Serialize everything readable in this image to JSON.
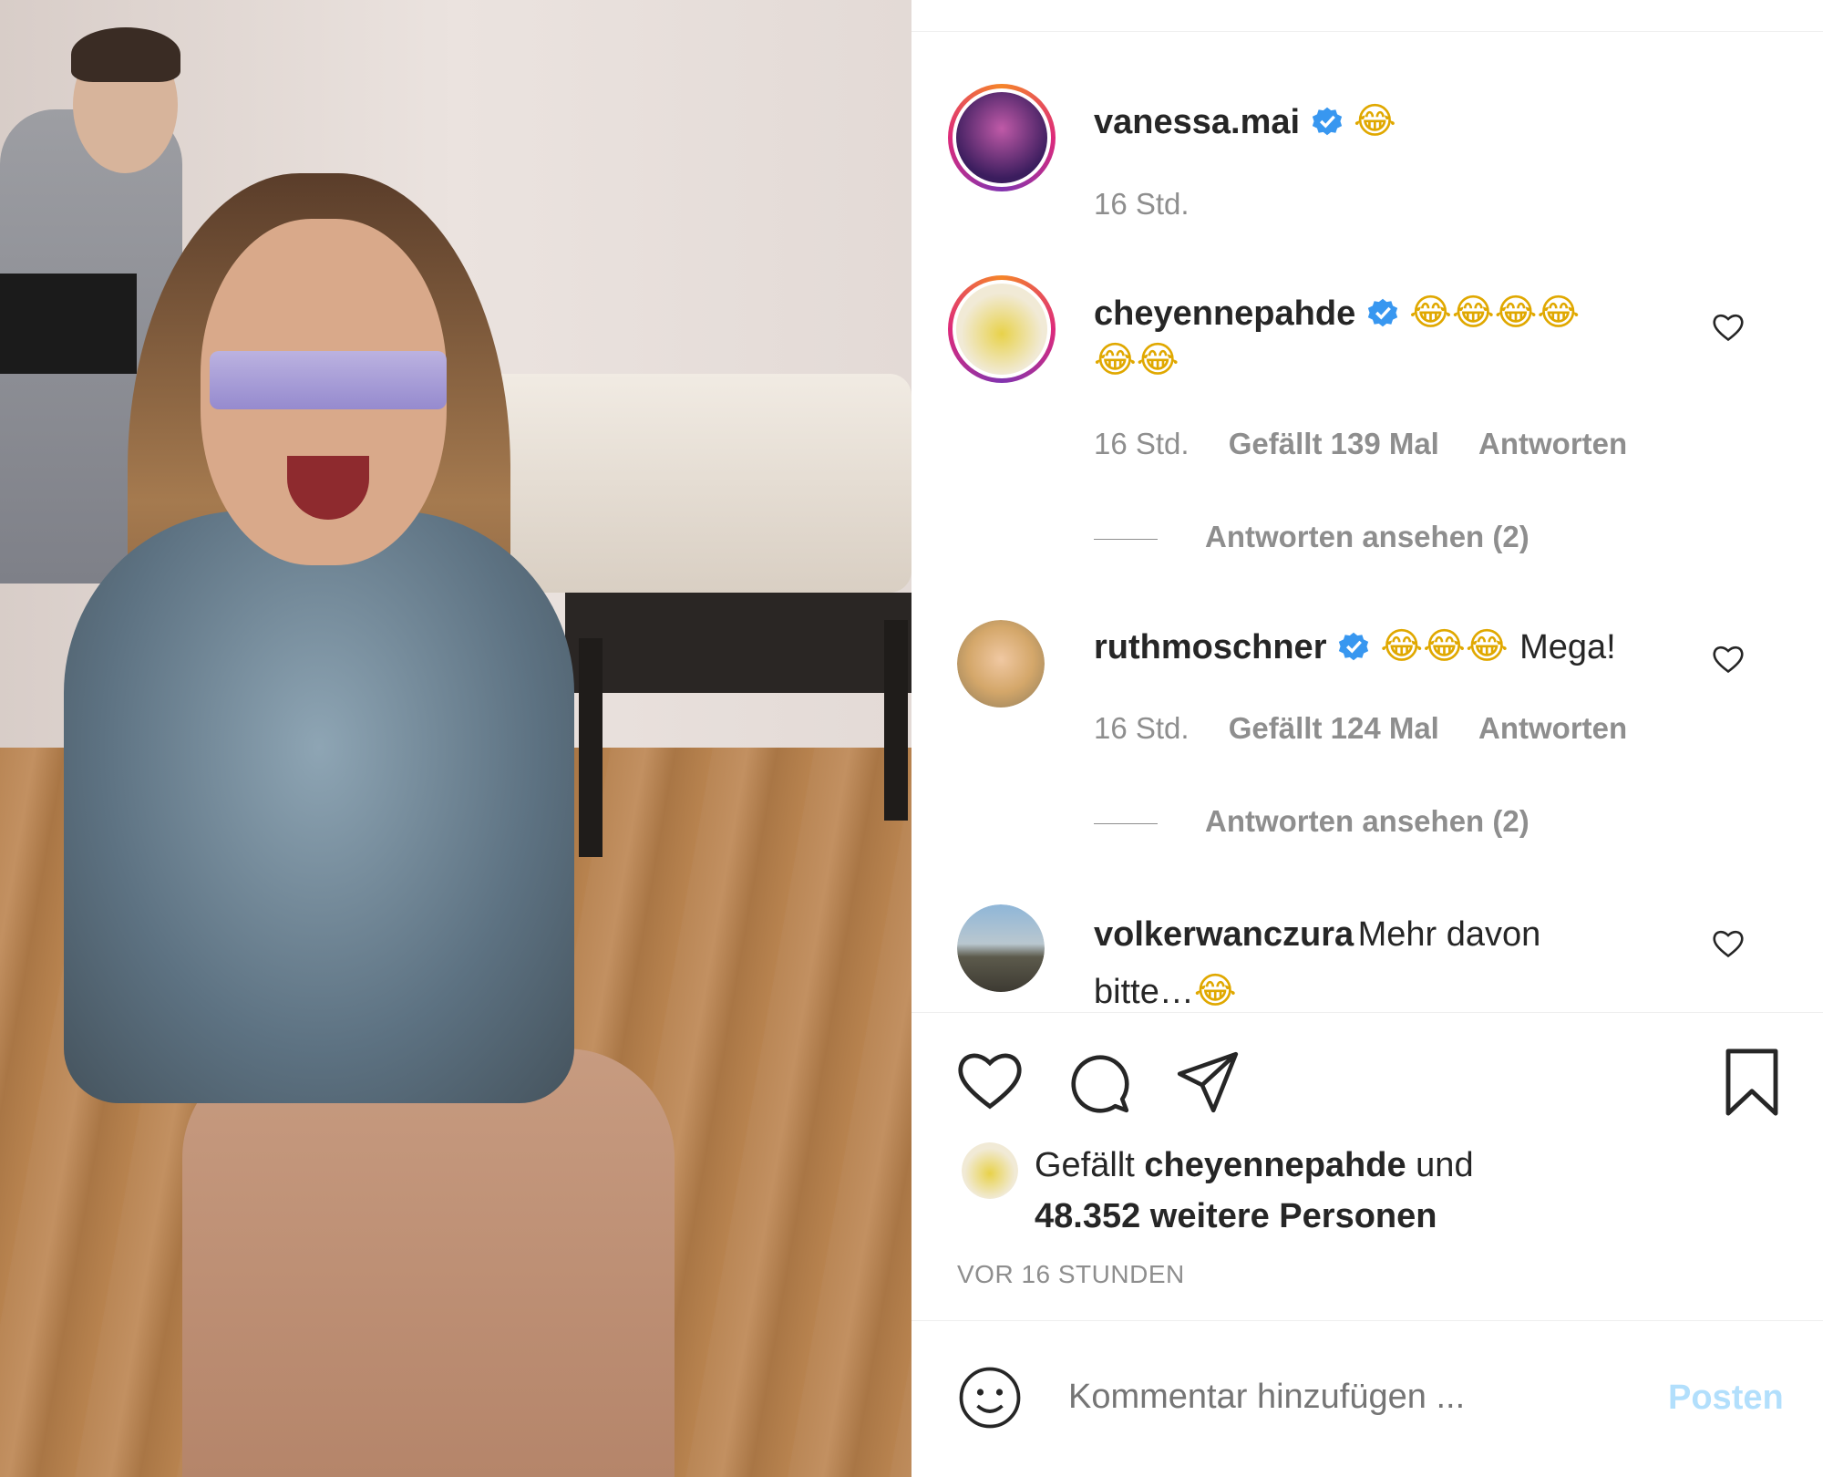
{
  "post": {
    "author": "vanessa.mai",
    "caption_emoji": "😂",
    "time": "16 Std."
  },
  "comments": [
    {
      "user": "cheyennepahde",
      "emojis_line1": "😂😂😂😂",
      "emojis_line2": "😂😂",
      "time": "16 Std.",
      "likes": "Gefällt 139 Mal",
      "reply_label": "Antworten",
      "view_replies": "Antworten ansehen (2)"
    },
    {
      "user": "ruthmoschner",
      "emojis": "😂😂😂",
      "text": "Mega!",
      "time": "16 Std.",
      "likes": "Gefällt 124 Mal",
      "reply_label": "Antworten",
      "view_replies": "Antworten ansehen (2)"
    },
    {
      "user": "volkerwanczura",
      "text1": "Mehr davon",
      "text2": "bitte…",
      "emoji": "😂"
    }
  ],
  "likes_summary": {
    "prefix": "Gefällt",
    "user": "cheyennepahde",
    "mid": "und",
    "others": "48.352 weitere Personen"
  },
  "time_ago": "VOR 16 STUNDEN",
  "comment_box": {
    "placeholder": "Kommentar hinzufügen ...",
    "post_label": "Posten"
  },
  "colors": {
    "verified": "#3897f0",
    "text": "#262626",
    "muted": "#8e8e8e",
    "post_disabled": "#b2dffc"
  },
  "icons": [
    "heart-icon",
    "comment-icon",
    "share-icon",
    "bookmark-icon",
    "emoji-icon",
    "verified-icon"
  ]
}
